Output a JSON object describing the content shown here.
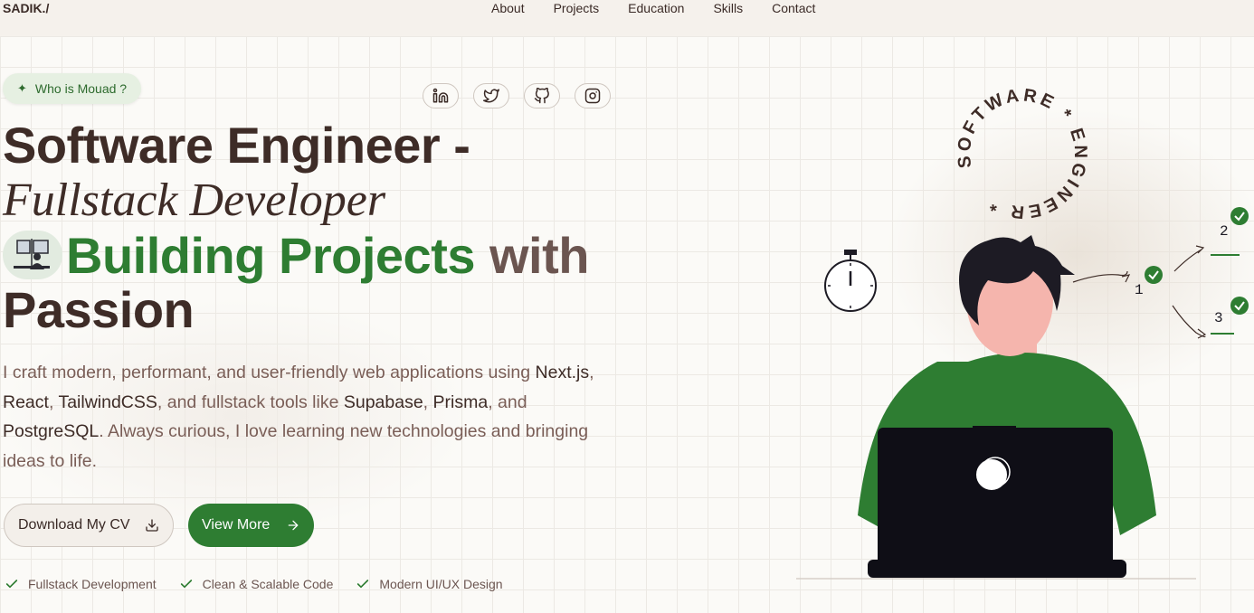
{
  "header": {
    "logo": "SADIK./",
    "nav": [
      "About",
      "Projects",
      "Education",
      "Skills",
      "Contact"
    ]
  },
  "hero": {
    "badge": "Who is Mouad ?",
    "socials": [
      "linkedin-icon",
      "twitter-icon",
      "github-icon",
      "instagram-icon"
    ],
    "title_line1": "Software Engineer -",
    "title_line2": "Fullstack Developer",
    "title_green": "Building Projects",
    "title_with": "with",
    "title_line4": "Passion",
    "paragraph": {
      "p1": "I craft modern, performant, and user-friendly web applications using ",
      "t1": "Next.js",
      "p2": ", ",
      "t2": "React",
      "p3": ", ",
      "t3": "TailwindCSS",
      "p4": ", and fullstack tools like ",
      "t4": "Supabase",
      "p5": ", ",
      "t5": "Prisma",
      "p6": ", and ",
      "t6": "PostgreSQL",
      "p7": ". Always curious, I love learning new technologies and bringing ideas to life."
    },
    "buttons": {
      "cv": "Download My CV",
      "more": "View More"
    },
    "features": [
      "Fullstack Development",
      "Clean & Scalable Code",
      "Modern UI/UX Design"
    ]
  },
  "illustration": {
    "ring_text": "SOFTWARE * ENGINEER * ",
    "steps": [
      "1",
      "2",
      "3"
    ]
  },
  "colors": {
    "accent": "#2e7d32",
    "text": "#3e2c27",
    "muted": "#7a5e57"
  }
}
